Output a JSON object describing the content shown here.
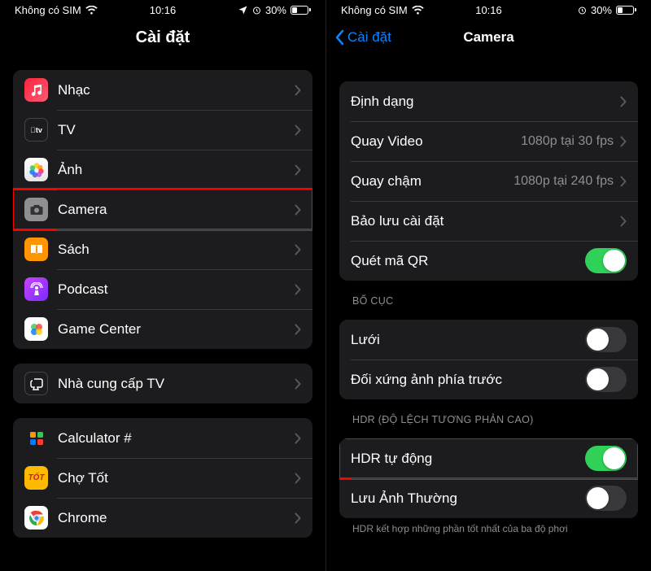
{
  "status": {
    "carrier": "Không có SIM",
    "time": "10:16",
    "battery_pct": "30%"
  },
  "left": {
    "title": "Cài đặt",
    "rows": [
      {
        "name": "music",
        "label": "Nhạc",
        "iconClass": "ic-music"
      },
      {
        "name": "tv",
        "label": "TV",
        "iconClass": "ic-tv"
      },
      {
        "name": "photos",
        "label": "Ảnh",
        "iconClass": "ic-photos"
      },
      {
        "name": "camera",
        "label": "Camera",
        "iconClass": "ic-camera",
        "highlight": true
      },
      {
        "name": "books",
        "label": "Sách",
        "iconClass": "ic-books"
      },
      {
        "name": "podcast",
        "label": "Podcast",
        "iconClass": "ic-podcast"
      },
      {
        "name": "gamecenter",
        "label": "Game Center",
        "iconClass": "ic-gamecenter"
      }
    ],
    "group2": [
      {
        "name": "tvprovider",
        "label": "Nhà cung cấp TV",
        "iconClass": "ic-tvprovider"
      }
    ],
    "group3": [
      {
        "name": "calc",
        "label": "Calculator #",
        "iconClass": "ic-calc"
      },
      {
        "name": "chotot",
        "label": "Chợ Tốt",
        "iconClass": "ic-chotot"
      },
      {
        "name": "chrome",
        "label": "Chrome",
        "iconClass": "ic-chrome"
      }
    ]
  },
  "right": {
    "back": "Cài đặt",
    "title": "Camera",
    "group1": [
      {
        "name": "format",
        "label": "Định dạng",
        "value": "",
        "chevron": true
      },
      {
        "name": "record-video",
        "label": "Quay Video",
        "value": "1080p tại 30 fps",
        "chevron": true
      },
      {
        "name": "slo-mo",
        "label": "Quay chậm",
        "value": "1080p tại 240 fps",
        "chevron": true
      },
      {
        "name": "preserve",
        "label": "Bảo lưu cài đặt",
        "value": "",
        "chevron": true
      },
      {
        "name": "scan-qr",
        "label": "Quét mã QR",
        "toggle": true,
        "on": true
      }
    ],
    "group2_header": "Bố cục",
    "group2": [
      {
        "name": "grid",
        "label": "Lưới",
        "toggle": true,
        "on": false
      },
      {
        "name": "mirror",
        "label": "Đối xứng ảnh phía trước",
        "toggle": true,
        "on": false
      }
    ],
    "group3_header": "HDR (Độ lệch tương phản cao)",
    "group3": [
      {
        "name": "smart-hdr",
        "label": "HDR tự động",
        "toggle": true,
        "on": true,
        "highlight": true
      },
      {
        "name": "keep-normal",
        "label": "Lưu Ảnh Thường",
        "toggle": true,
        "on": false
      }
    ],
    "footer": "HDR kết hợp những phần tốt nhất của ba độ phơi"
  }
}
